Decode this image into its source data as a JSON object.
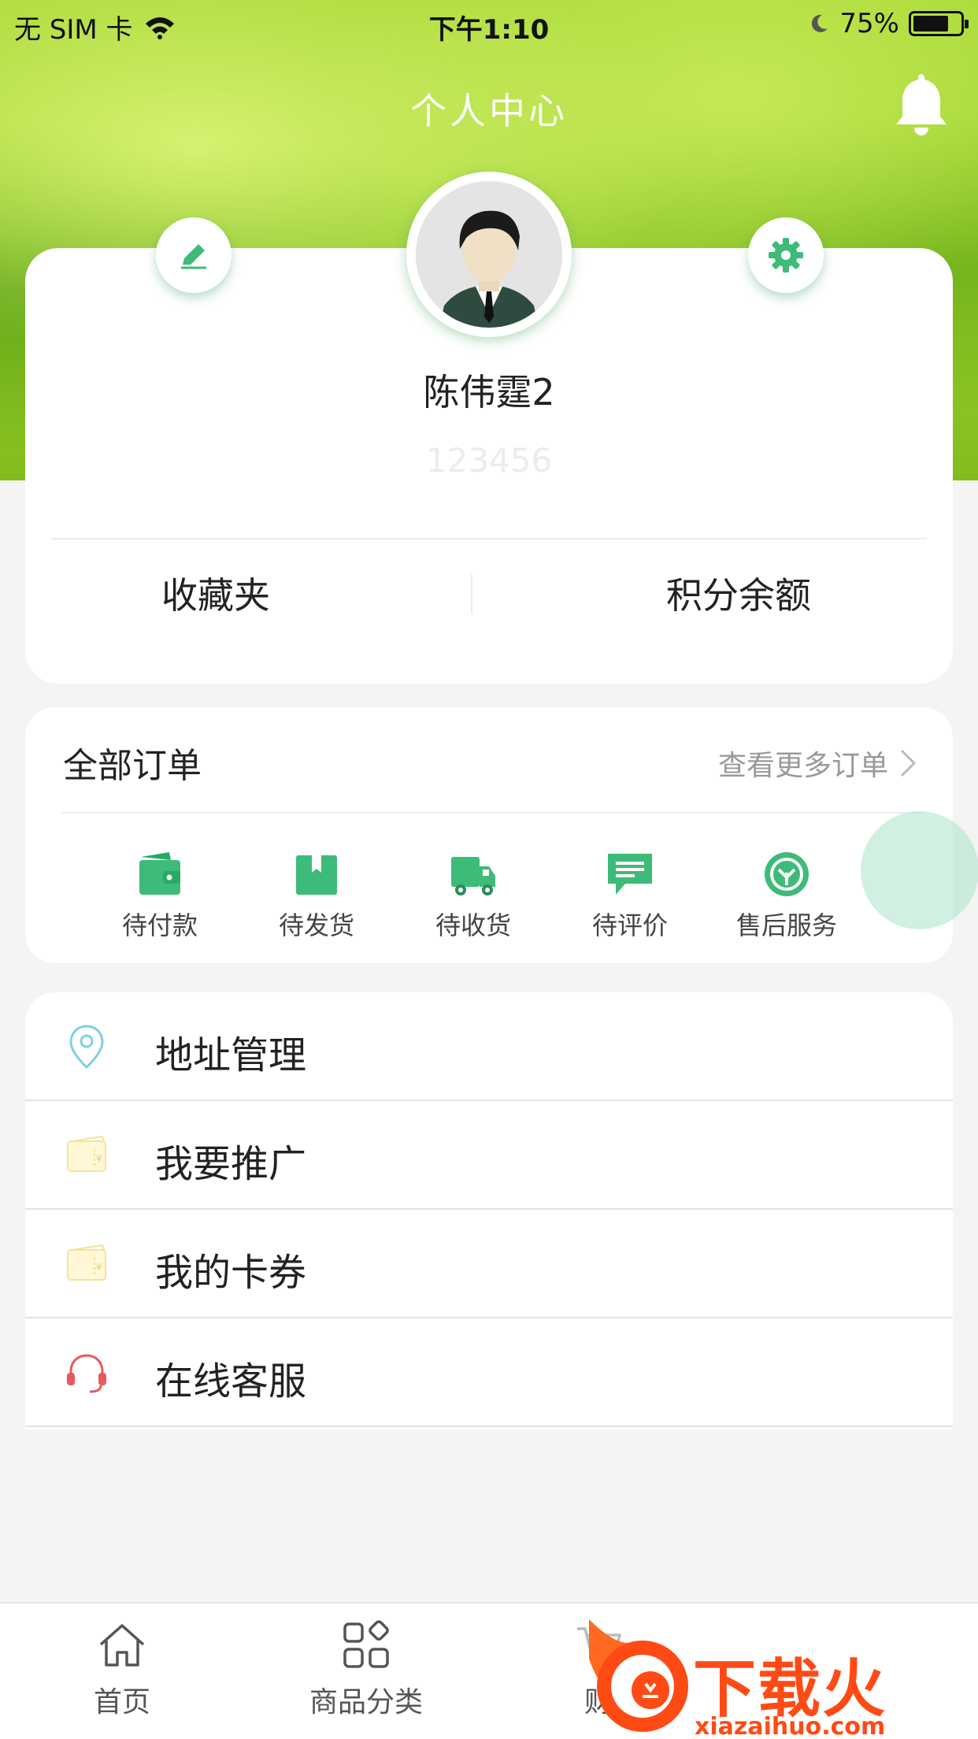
{
  "status_bar": {
    "carrier": "无 SIM 卡",
    "time": "下午1:10",
    "battery_percent": "75%",
    "battery_level": 0.75
  },
  "header": {
    "title": "个人中心"
  },
  "profile": {
    "name": "陈伟霆2",
    "user_id": "123456"
  },
  "quick_links": [
    {
      "label": "收藏夹"
    },
    {
      "label": "积分余额"
    }
  ],
  "orders": {
    "title": "全部订单",
    "more_label": "查看更多订单",
    "items": [
      {
        "label": "待付款",
        "icon": "wallet-icon"
      },
      {
        "label": "待发货",
        "icon": "package-icon"
      },
      {
        "label": "待收货",
        "icon": "truck-icon"
      },
      {
        "label": "待评价",
        "icon": "comment-icon"
      },
      {
        "label": "售后服务",
        "icon": "service-icon"
      }
    ]
  },
  "menu": [
    {
      "label": "地址管理",
      "icon": "location-pin-icon"
    },
    {
      "label": "我要推广",
      "icon": "ticket-icon"
    },
    {
      "label": "我的卡券",
      "icon": "ticket-icon"
    },
    {
      "label": "在线客服",
      "icon": "headset-icon"
    }
  ],
  "tabbar": [
    {
      "label": "首页",
      "icon": "home-icon"
    },
    {
      "label": "商品分类",
      "icon": "category-grid-icon"
    },
    {
      "label": "财",
      "icon": "cart-icon"
    }
  ],
  "watermark": {
    "text": "下载火",
    "url": "xiazaihuo.com"
  },
  "colors": {
    "accent_green": "#3dbb78",
    "hero_green": "#9bd12c",
    "watermark_orange": "#ff4a14"
  }
}
